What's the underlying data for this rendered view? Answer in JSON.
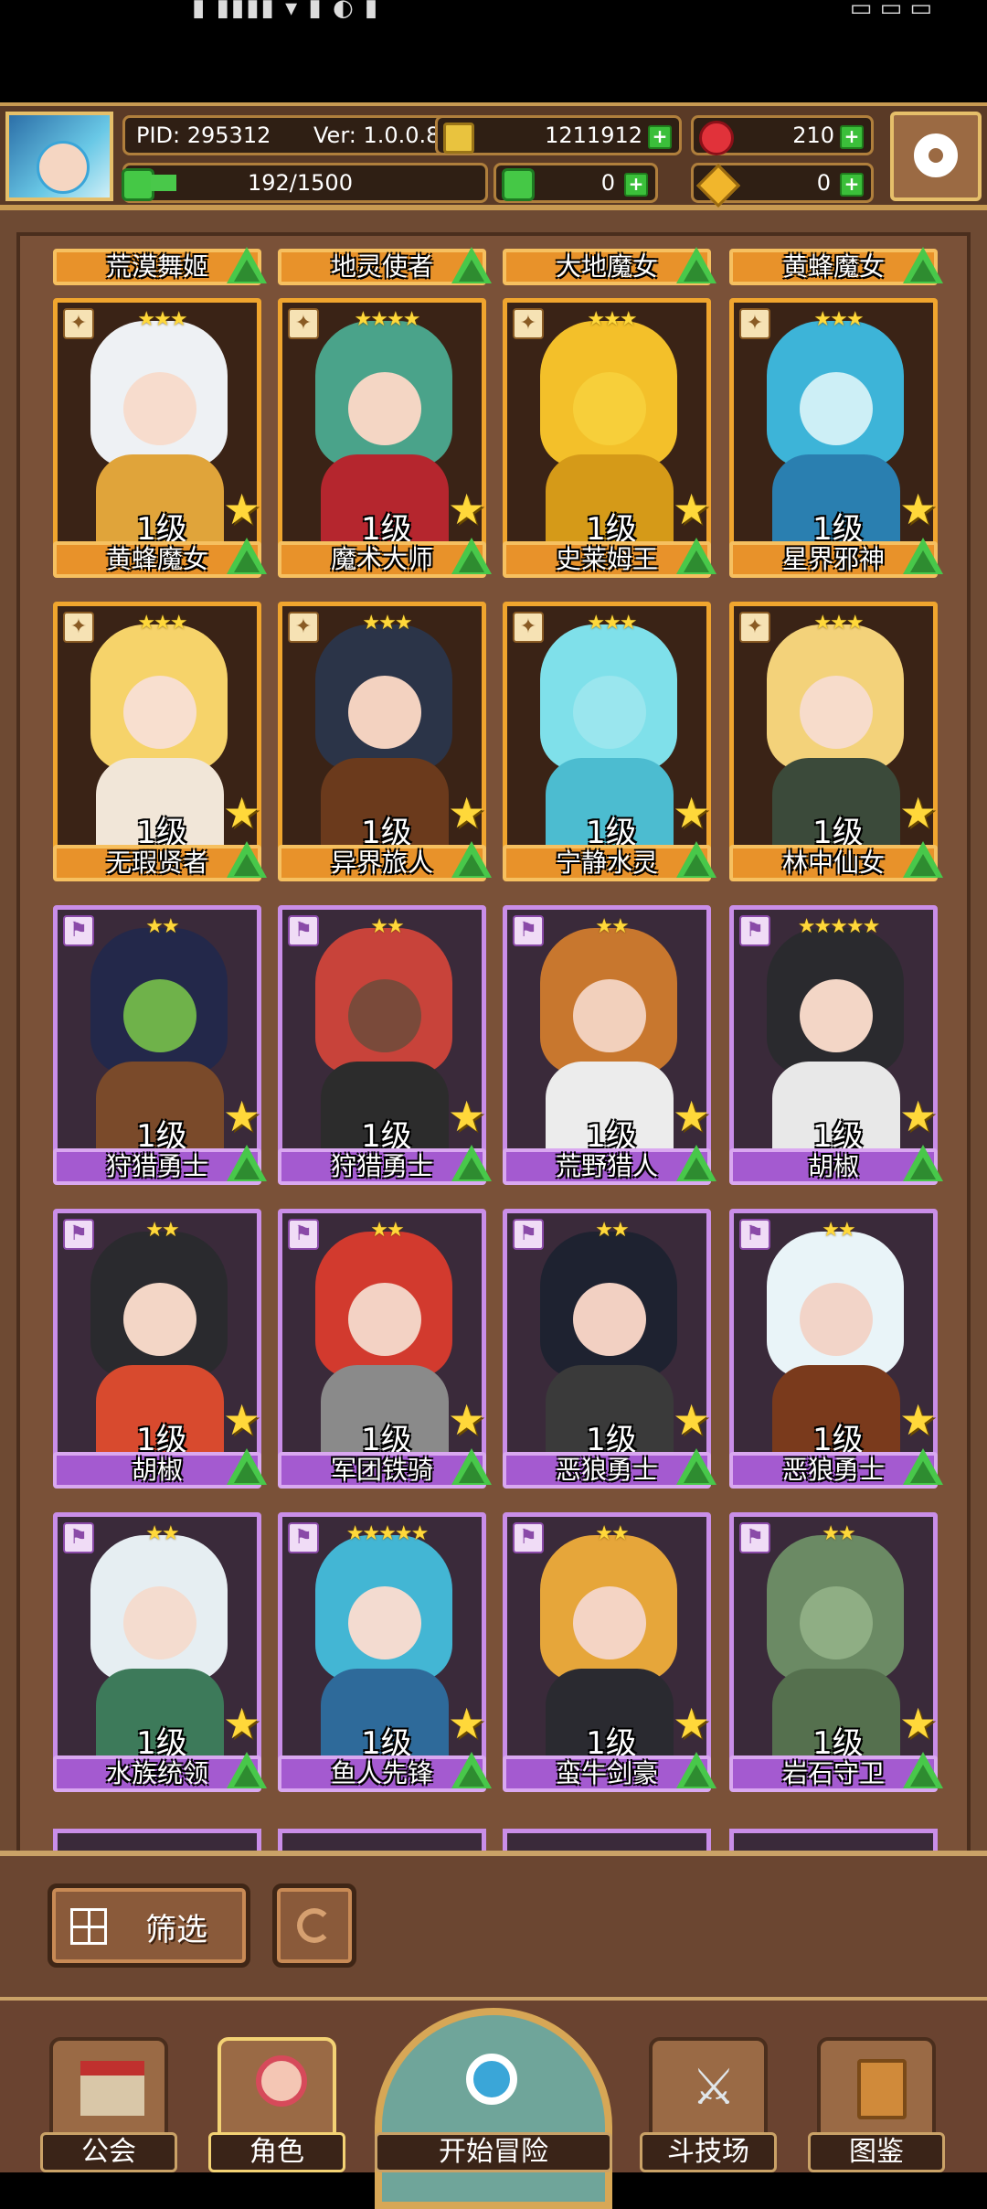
{
  "header": {
    "pid": "PID: 295312",
    "version": "Ver: 1.0.0.8",
    "gold": "1211912",
    "ruby": "210",
    "energy": "192/1500",
    "clover": "0",
    "token": "0"
  },
  "top_row_names": [
    "荒漠舞姬",
    "地灵使者",
    "大地魔女",
    "黄蜂魔女"
  ],
  "cards": [
    {
      "name": "黄蜂魔女",
      "level": "1级",
      "stars": "★★★",
      "rarity": "gold",
      "hair": "#eef1f4",
      "skin": "#f7dccd",
      "outfit": "#e0a43a"
    },
    {
      "name": "魔术大师",
      "level": "1级",
      "stars": "★★★★",
      "rarity": "gold",
      "hair": "#4aa38a",
      "skin": "#f4d6c4",
      "outfit": "#b5262e"
    },
    {
      "name": "史莱姆王",
      "level": "1级",
      "stars": "★★★",
      "rarity": "gold",
      "hair": "#f3c02a",
      "skin": "#f7cf3a",
      "outfit": "#d59a18"
    },
    {
      "name": "星界邪神",
      "level": "1级",
      "stars": "★★★",
      "rarity": "gold",
      "hair": "#3db4d8",
      "skin": "#cdeff6",
      "outfit": "#2a7fb0"
    },
    {
      "name": "无瑕贤者",
      "level": "1级",
      "stars": "★★★",
      "rarity": "gold",
      "hair": "#f6d36a",
      "skin": "#f8dfcf",
      "outfit": "#f1e6d8"
    },
    {
      "name": "异界旅人",
      "level": "1级",
      "stars": "★★★",
      "rarity": "gold",
      "hair": "#2b3448",
      "skin": "#f3d2c0",
      "outfit": "#6b3a1c"
    },
    {
      "name": "宁静水灵",
      "level": "1级",
      "stars": "★★★",
      "rarity": "gold",
      "hair": "#7fe0ea",
      "skin": "#9ae6ee",
      "outfit": "#4cbcd0"
    },
    {
      "name": "林中仙女",
      "level": "1级",
      "stars": "★★★",
      "rarity": "gold",
      "hair": "#f3d27a",
      "skin": "#f7dccb",
      "outfit": "#3b4a3a"
    },
    {
      "name": "狩猎勇士",
      "level": "1级",
      "stars": "★★",
      "rarity": "purple",
      "hair": "#23284a",
      "skin": "#6fb24a",
      "outfit": "#7a4a2a"
    },
    {
      "name": "狩猎勇士",
      "level": "1级",
      "stars": "★★",
      "rarity": "purple",
      "hair": "#c8433a",
      "skin": "#7a4a3a",
      "outfit": "#2c2c2c"
    },
    {
      "name": "荒野猎人",
      "level": "1级",
      "stars": "★★",
      "rarity": "purple",
      "hair": "#c8772e",
      "skin": "#f2d0bc",
      "outfit": "#ececec"
    },
    {
      "name": "胡椒",
      "level": "1级",
      "stars": "★★★★★",
      "rarity": "purple",
      "hair": "#2a2a2e",
      "skin": "#f3d6c6",
      "outfit": "#e8e8e8"
    },
    {
      "name": "胡椒",
      "level": "1级",
      "stars": "★★",
      "rarity": "purple",
      "hair": "#2a2a2e",
      "skin": "#f3d6c6",
      "outfit": "#d84a2e"
    },
    {
      "name": "军团铁骑",
      "level": "1级",
      "stars": "★★",
      "rarity": "purple",
      "hair": "#d23a2e",
      "skin": "#f3d2c4",
      "outfit": "#8a8a8a"
    },
    {
      "name": "恶狼勇士",
      "level": "1级",
      "stars": "★★",
      "rarity": "purple",
      "hair": "#1e2230",
      "skin": "#f2d0c2",
      "outfit": "#3a3a3a"
    },
    {
      "name": "恶狼勇士",
      "level": "1级",
      "stars": "★★",
      "rarity": "purple",
      "hair": "#e9f4f8",
      "skin": "#f2d4c8",
      "outfit": "#7a3a1c"
    },
    {
      "name": "水族统领",
      "level": "1级",
      "stars": "★★",
      "rarity": "purple",
      "hair": "#e6eef2",
      "skin": "#f4dccf",
      "outfit": "#3d7a5a"
    },
    {
      "name": "鱼人先锋",
      "level": "1级",
      "stars": "★★★★★",
      "rarity": "purple",
      "hair": "#43b6d4",
      "skin": "#f3dbd0",
      "outfit": "#2e6a9a"
    },
    {
      "name": "蛮牛剑豪",
      "level": "1级",
      "stars": "★★",
      "rarity": "purple",
      "hair": "#e6a63a",
      "skin": "#f4d4c4",
      "outfit": "#2a2a30"
    },
    {
      "name": "岩石守卫",
      "level": "1级",
      "stars": "★★",
      "rarity": "purple",
      "hair": "#6b8a64",
      "skin": "#8fae84",
      "outfit": "#55704e"
    }
  ],
  "filter": {
    "label": "筛选"
  },
  "nav": {
    "guild": "公会",
    "role": "角色",
    "adventure": "开始冒险",
    "arena": "斗技场",
    "codex": "图鉴"
  },
  "colors": {
    "gold_frame": "#f0a52e",
    "purple_frame": "#c98ee8",
    "upgrade_green": "#48c84a"
  }
}
